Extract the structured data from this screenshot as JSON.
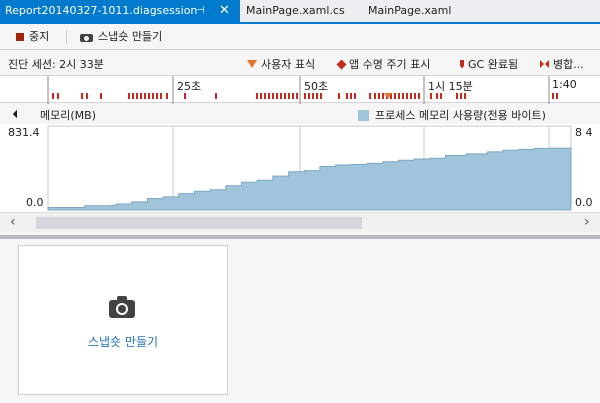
{
  "tabs": [
    {
      "label": "Report20140327-1011.diagsession",
      "active": true
    },
    {
      "label": "MainPage.xaml.cs",
      "active": false
    },
    {
      "label": "MainPage.xaml",
      "active": false
    }
  ],
  "tab_pin_glyph": "⊣",
  "tab_close_glyph": "✕",
  "toolbar": {
    "stop_label": "중지",
    "snapshot_label": "스냅숏 만들기"
  },
  "session": {
    "label": "진단 세션: 2시 33분"
  },
  "legend": {
    "user_mark": "사용자 표식",
    "app_lifecycle": "앱 수명 주기 표시",
    "gc_complete": "GC 완료됨",
    "merged": "병합..."
  },
  "ruler": {
    "ticks": [
      "25초",
      "50초",
      "1시 15분",
      "1:40"
    ]
  },
  "chart_header": {
    "title": "메모리(MB)",
    "series_label": "프로세스 메모리 사용량(전용 바이트)"
  },
  "chart_data": {
    "type": "area",
    "title": "메모리(MB)",
    "ylabel": "",
    "ylim": [
      0.0,
      831.4
    ],
    "y_max_label": "831.4",
    "y_min_label": "0.0",
    "y_max_label_right": "8 4",
    "y_min_label_right": "0.0",
    "series": [
      {
        "name": "프로세스 메모리 사용량(전용 바이트)",
        "color": "#a0c4da",
        "x": [
          0.0,
          0.06,
          0.07,
          0.12,
          0.13,
          0.16,
          0.19,
          0.22,
          0.25,
          0.28,
          0.31,
          0.34,
          0.37,
          0.4,
          0.43,
          0.46,
          0.49,
          0.52,
          0.55,
          0.58,
          0.61,
          0.64,
          0.67,
          0.7,
          0.73,
          0.76,
          0.8,
          0.84,
          0.87,
          0.9,
          0.93,
          0.96,
          0.99,
          1.0
        ],
        "y": [
          25,
          25,
          42,
          45,
          60,
          80,
          112,
          130,
          162,
          185,
          200,
          240,
          275,
          295,
          335,
          378,
          390,
          430,
          445,
          450,
          462,
          478,
          492,
          505,
          512,
          540,
          555,
          575,
          592,
          600,
          610,
          612,
          612,
          612
        ]
      }
    ]
  },
  "icons": {
    "stop": "stop-square-icon",
    "camera": "camera-icon",
    "user_mark": "orange-triangle-icon",
    "lifecycle": "red-diamond-icon",
    "gc": "gc-marker-icon",
    "merged": "bowtie-icon"
  },
  "colors": {
    "accent": "#007acc",
    "area_fill": "#a0c4da",
    "event_red": "#c42b1c",
    "user_mark_orange": "#e8722c",
    "link_blue": "#1e6fb8"
  },
  "scrollbar": {
    "left_glyph": "‹",
    "right_glyph": "›"
  },
  "snapshot_card": {
    "link_label": "스냅숏 만들기"
  }
}
